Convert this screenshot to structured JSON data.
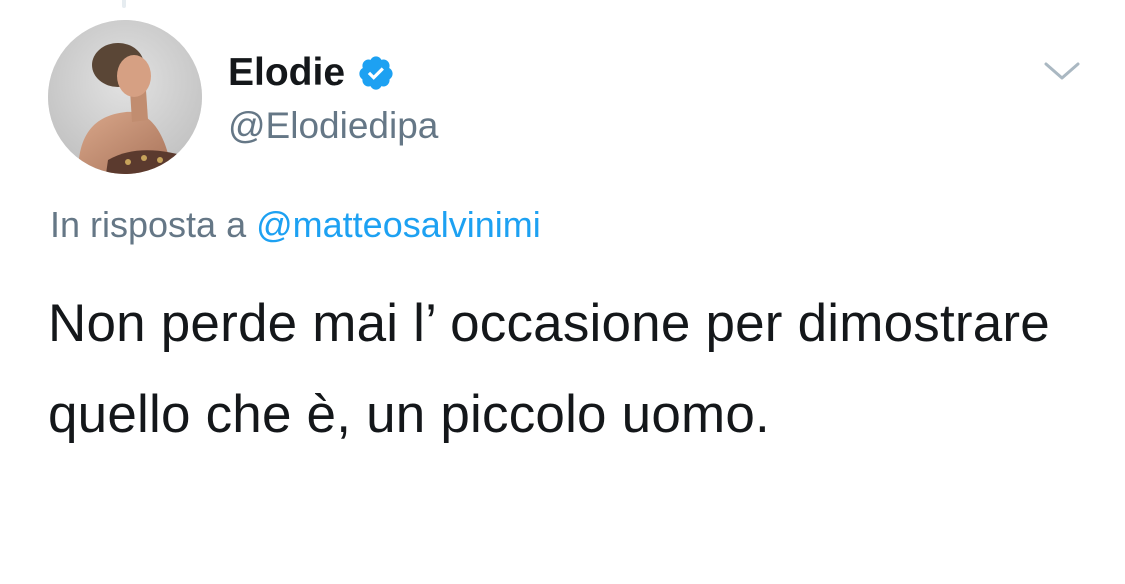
{
  "tweet": {
    "author": {
      "display_name": "Elodie",
      "handle": "@Elodiedipa",
      "verified": true,
      "avatar_icon": "profile-photo"
    },
    "reply_context": {
      "prefix": "In risposta a",
      "mention": "@matteosalvinimi"
    },
    "text": "Non perde mai l’ occasione per dimostrare quello che è, un piccolo uomo.",
    "menu_icon": "chevron-down-icon"
  },
  "colors": {
    "text_primary": "#14171a",
    "text_secondary": "#657786",
    "link": "#1da1f2",
    "verified_badge": "#1da1f2"
  }
}
